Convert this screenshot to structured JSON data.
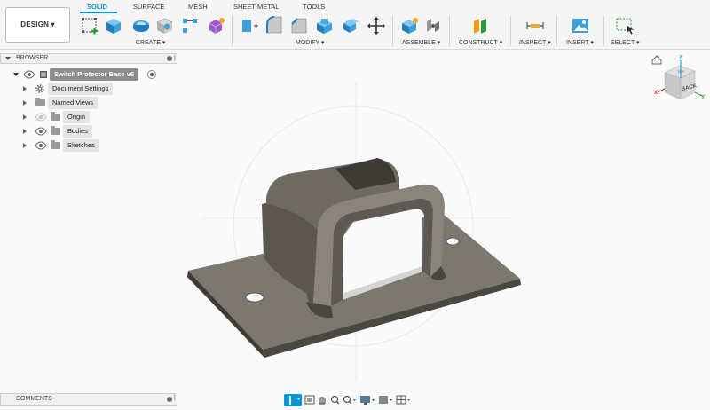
{
  "toolbar": {
    "design_label": "DESIGN ▾",
    "tabs": [
      {
        "label": "SOLID",
        "active": true
      },
      {
        "label": "SURFACE",
        "active": false
      },
      {
        "label": "MESH",
        "active": false
      },
      {
        "label": "SHEET METAL",
        "active": false
      },
      {
        "label": "TOOLS",
        "active": false
      }
    ],
    "groups": [
      {
        "label": "CREATE ▾",
        "tools": [
          "create-sketch-icon",
          "extrude-icon",
          "revolve-icon",
          "hole-icon",
          "pattern-icon",
          "create-form-icon"
        ]
      },
      {
        "label": "MODIFY ▾",
        "tools": [
          "press-pull-icon",
          "fillet-icon",
          "chamfer-icon",
          "shell-icon",
          "combine-icon",
          "move-copy-icon"
        ]
      },
      {
        "label": "ASSEMBLE ▾",
        "tools": [
          "new-component-icon",
          "joint-icon"
        ]
      },
      {
        "label": "CONSTRUCT ▾",
        "tools": [
          "offset-plane-icon"
        ]
      },
      {
        "label": "INSPECT ▾",
        "tools": [
          "measure-icon"
        ]
      },
      {
        "label": "INSERT ▾",
        "tools": [
          "insert-image-icon"
        ]
      },
      {
        "label": "SELECT ▾",
        "tools": [
          "select-window-icon"
        ]
      }
    ]
  },
  "browser": {
    "title": "BROWSER",
    "root": {
      "label": "Switch Protector Base v6"
    },
    "items": [
      {
        "label": "Document Settings",
        "icon": "gear-icon"
      },
      {
        "label": "Named Views",
        "icon": "folder-icon"
      },
      {
        "label": "Origin",
        "icon": "folder-icon",
        "visibility": "hidden"
      },
      {
        "label": "Bodies",
        "icon": "folder-icon",
        "visibility": "visible"
      },
      {
        "label": "Sketches",
        "icon": "folder-icon",
        "visibility": "visible"
      }
    ]
  },
  "comments": {
    "title": "COMMENTS"
  },
  "viewcube": {
    "face_front": "BACK",
    "face_top": "TOP",
    "axes": [
      "X",
      "Y",
      "Z"
    ]
  },
  "colors": {
    "accent": "#0696d7",
    "model": "#5b5750",
    "model_light": "#7a756d",
    "model_dark": "#3d3a35",
    "background": "#fafafa"
  }
}
